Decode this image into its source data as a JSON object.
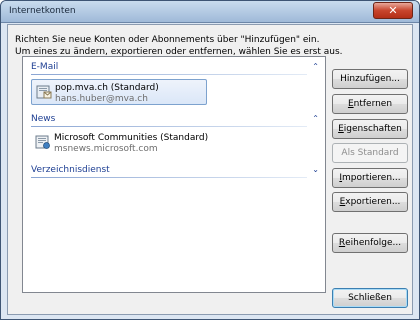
{
  "window": {
    "title": "Internetkonten",
    "close_glyph": "✕"
  },
  "description": {
    "line1": "Richten Sie neue Konten oder Abonnements über \"Hinzufügen\" ein.",
    "line2": "Um eines zu ändern, exportieren oder entfernen, wählen Sie es erst aus."
  },
  "groups": {
    "email": {
      "label": "E-Mail",
      "chevron": "⌃",
      "account": {
        "name": "pop.mva.ch (Standard)",
        "detail": "hans.huber@mva.ch",
        "icon": "mail-server-icon",
        "selected": true
      }
    },
    "news": {
      "label": "News",
      "chevron": "⌃",
      "account": {
        "name": "Microsoft Communities (Standard)",
        "detail": "msnews.microsoft.com",
        "icon": "news-server-icon",
        "selected": false
      }
    },
    "directory": {
      "label": "Verzeichnisdienst",
      "chevron": "⌄"
    }
  },
  "buttons": {
    "add": {
      "pre": "Hinzufügen...",
      "enabled": true
    },
    "remove": {
      "u": "E",
      "rest": "ntfernen",
      "enabled": true
    },
    "properties": {
      "u": "E",
      "rest": "igenschaften",
      "enabled": true
    },
    "set_default": {
      "label": "Als Standard",
      "enabled": false
    },
    "import": {
      "u": "I",
      "rest": "mportieren...",
      "enabled": true
    },
    "export": {
      "u": "E",
      "rest": "xportieren...",
      "enabled": true
    },
    "order": {
      "u": "R",
      "rest": "eihenfolge...",
      "enabled": true
    },
    "close": {
      "label": "Schließen",
      "default": true
    }
  }
}
